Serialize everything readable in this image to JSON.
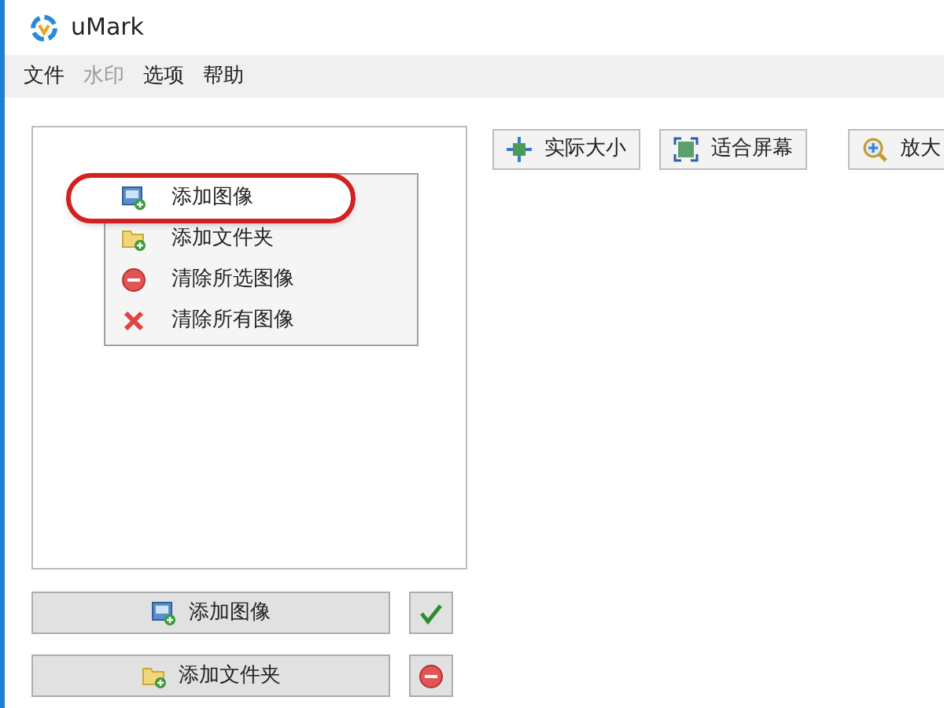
{
  "window": {
    "title": "uMark"
  },
  "menu": [
    {
      "label": "文件",
      "disabled": false
    },
    {
      "label": "水印",
      "disabled": true
    },
    {
      "label": "选项",
      "disabled": false
    },
    {
      "label": "帮助",
      "disabled": false
    }
  ],
  "context_menu": [
    {
      "label": "添加图像",
      "kind": "image",
      "selected": true
    },
    {
      "label": "添加文件夹",
      "kind": "folder",
      "selected": false
    },
    {
      "label": "清除所选图像",
      "kind": "minus",
      "selected": false
    },
    {
      "label": "清除所有图像",
      "kind": "cross",
      "selected": false
    }
  ],
  "toolbar": [
    {
      "label": "实际大小",
      "kind": "actual"
    },
    {
      "label": "适合屏幕",
      "kind": "fit"
    },
    {
      "label": "放大",
      "kind": "zoom"
    }
  ],
  "bottom_buttons": [
    {
      "label": "添加图像",
      "kind": "image"
    },
    {
      "label": "添加文件夹",
      "kind": "folder"
    }
  ],
  "side_buttons": [
    {
      "kind": "check"
    },
    {
      "kind": "minus"
    }
  ]
}
